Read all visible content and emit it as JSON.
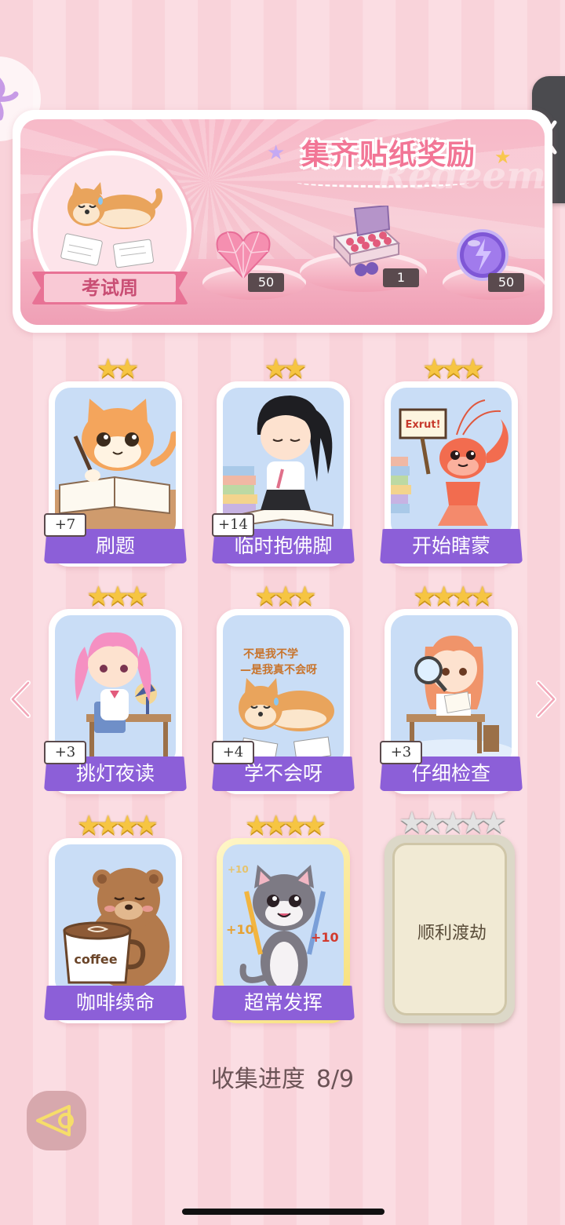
{
  "banner": {
    "title": "集齐贴纸奖励",
    "watermark": "Redeem",
    "set_name": "考试周",
    "rewards": [
      {
        "icon": "pink-heart-gem-icon",
        "count": "50"
      },
      {
        "icon": "gift-box-icon",
        "count": "1"
      },
      {
        "icon": "purple-energy-orb-icon",
        "count": "50"
      }
    ]
  },
  "cards": [
    {
      "name": "刷题",
      "stars": 2,
      "bonus": "+7",
      "art": "cat-studying-icon"
    },
    {
      "name": "临时抱佛脚",
      "stars": 2,
      "bonus": "+14",
      "art": "girl-reading-icon"
    },
    {
      "name": "开始瞎蒙",
      "stars": 3,
      "bonus": "",
      "art": "lobster-sign-icon",
      "sign_text": "Exrut!"
    },
    {
      "name": "挑灯夜读",
      "stars": 3,
      "bonus": "+3",
      "art": "girl-desk-lamp-icon"
    },
    {
      "name": "学不会呀",
      "stars": 3,
      "bonus": "+4",
      "art": "shiba-lying-icon",
      "art_text_1": "不是我不学",
      "art_text_2": "—是我真不会呀"
    },
    {
      "name": "仔细检查",
      "stars": 4,
      "bonus": "+3",
      "art": "girl-magnifier-icon"
    },
    {
      "name": "咖啡续命",
      "stars": 4,
      "bonus": "",
      "art": "bear-coffee-icon",
      "art_text_1": "coffee"
    },
    {
      "name": "超常发挥",
      "stars": 4,
      "bonus": "",
      "art": "cat-pencils-icon",
      "art_text_1": "+10",
      "art_text_2": "+10",
      "art_text_3": "+10"
    },
    {
      "name": "顺利渡劫",
      "stars": 5,
      "locked": true
    }
  ],
  "progress": {
    "label": "收集进度",
    "value": "8/9"
  },
  "colors": {
    "plate": "#8c5fd8",
    "accent": "#f27696",
    "star": "#f6c542"
  }
}
